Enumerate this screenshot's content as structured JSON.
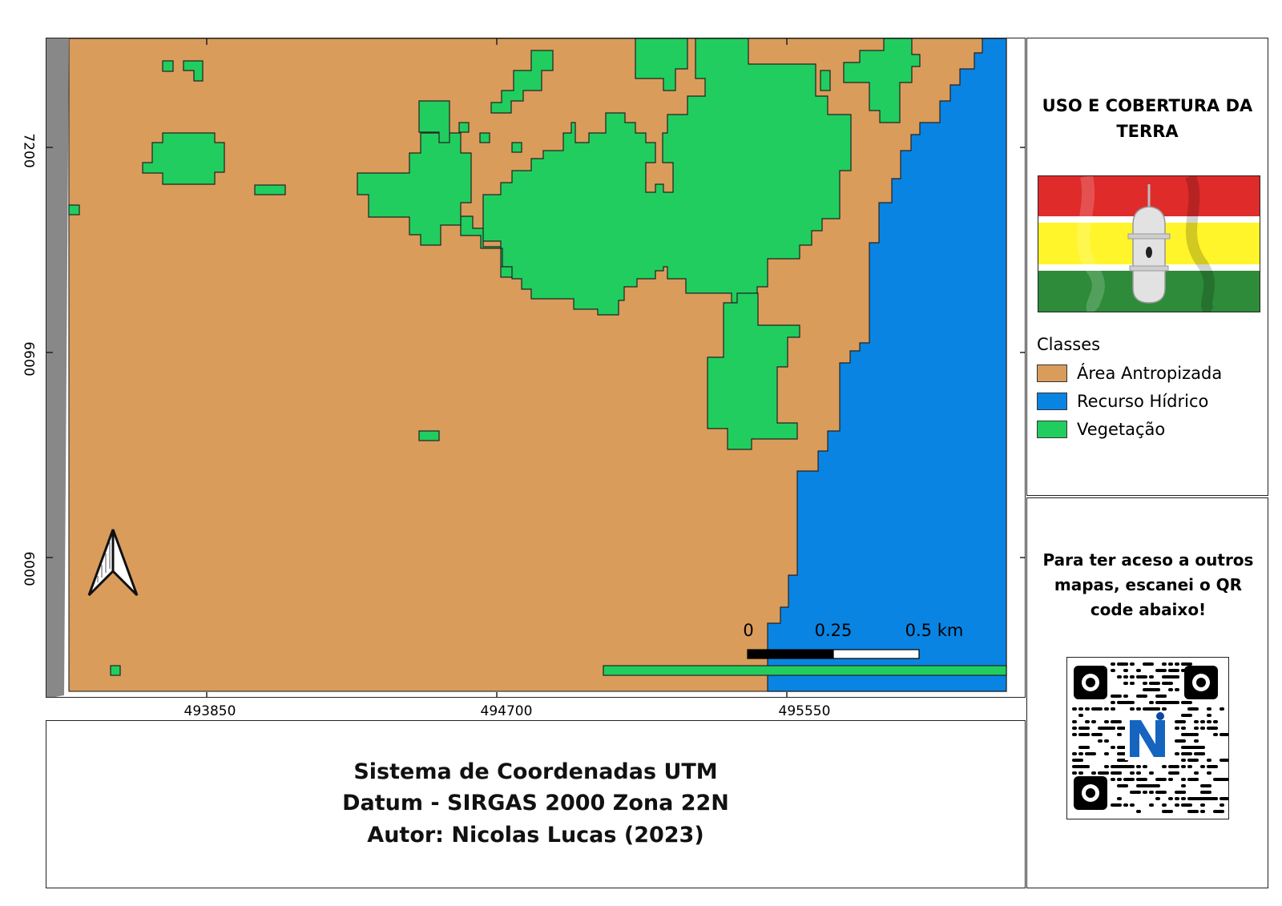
{
  "map": {
    "x_ticks": [
      "493850",
      "494700",
      "495550"
    ],
    "y_ticks": [
      "7200",
      "6600",
      "6000"
    ],
    "scale_bar": {
      "labels": [
        "0",
        "0.25",
        "0.5 km"
      ]
    },
    "north_arrow": "north-arrow-icon"
  },
  "info": {
    "line1": "Sistema de Coordenadas UTM",
    "line2": "Datum - SIRGAS 2000 Zona 22N",
    "line3": "Autor: Nicolas Lucas (2023)"
  },
  "legend": {
    "title": "USO E COBERTURA DA TERRA",
    "heading": "Classes",
    "items": [
      {
        "label": "Área Antropizada",
        "color": "#d99c5b"
      },
      {
        "label": "Recurso Hídrico",
        "color": "#0a84e2"
      },
      {
        "label": "Vegetação",
        "color": "#21cd5f"
      }
    ],
    "flag_colors": [
      "#e02b2b",
      "#fff52a",
      "#2e8b3a"
    ]
  },
  "qr": {
    "text": "Para ter aceso a outros mapas, escanei o QR code abaixo!"
  }
}
